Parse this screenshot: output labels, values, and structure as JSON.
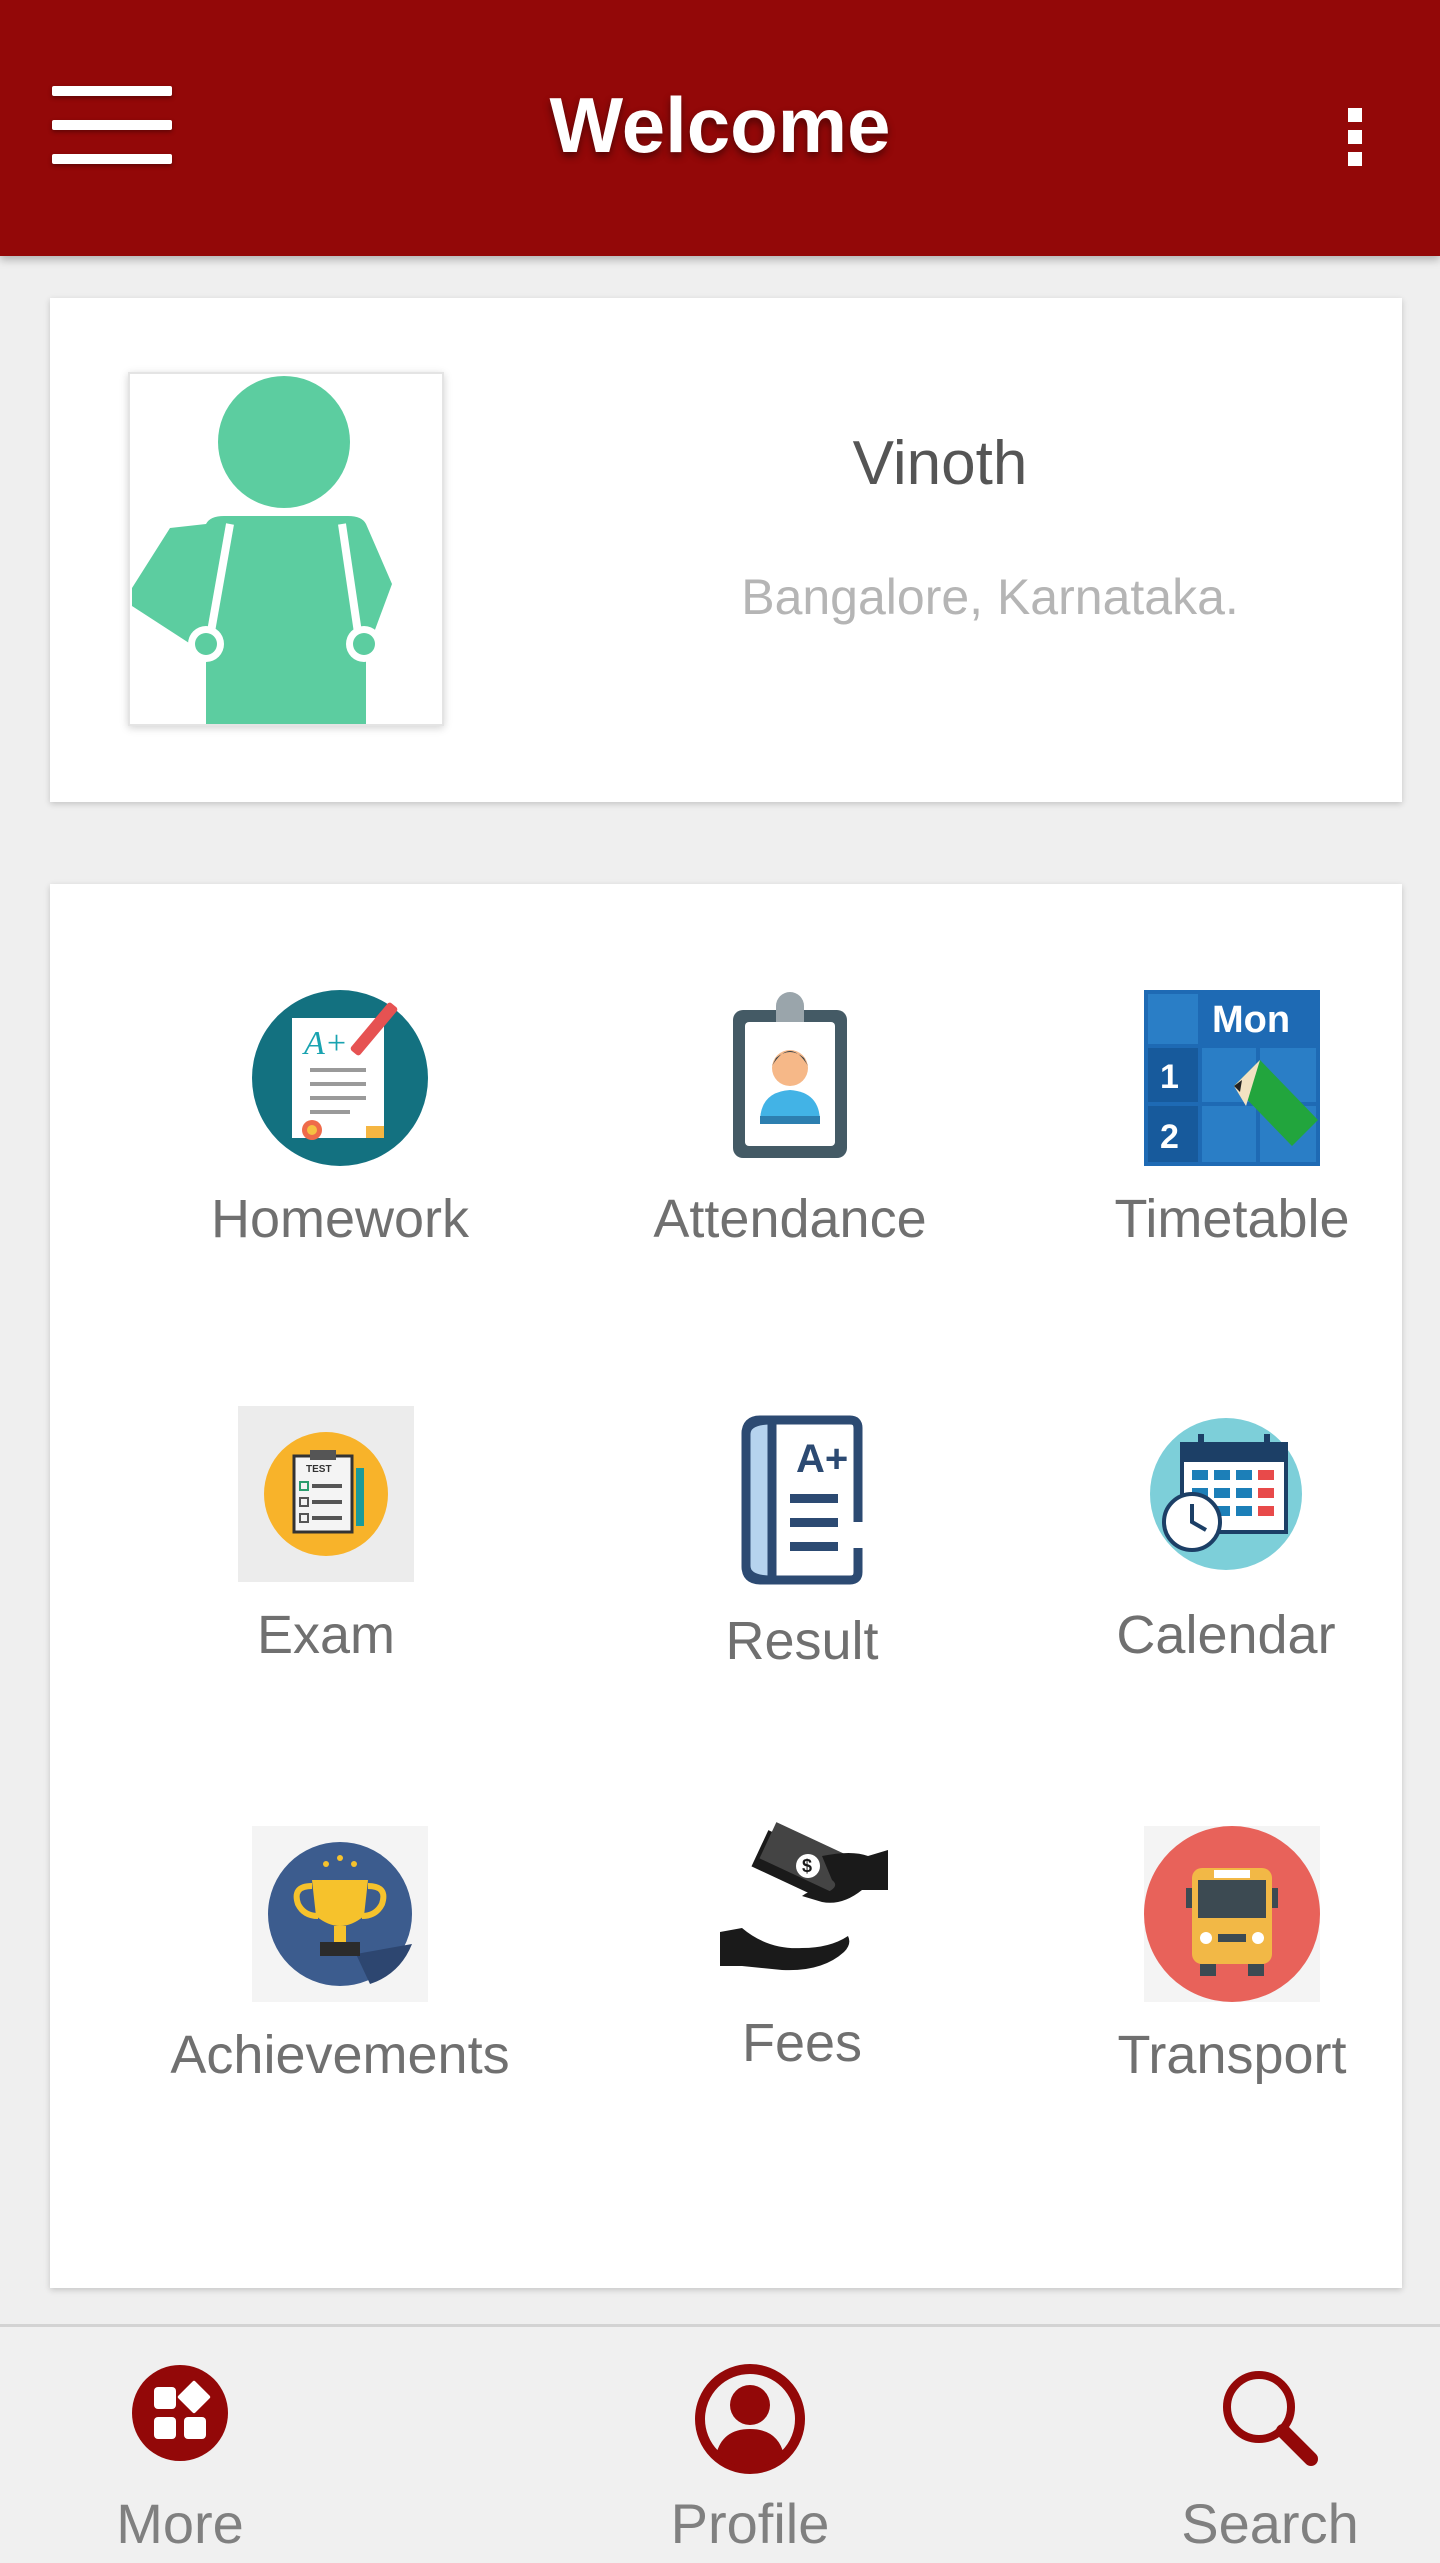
{
  "app_bar": {
    "title": "Welcome",
    "menu_icon": "hamburger-menu-icon",
    "overflow_icon": "more-vert-icon",
    "background": "#930808"
  },
  "profile": {
    "name": "Vinoth",
    "location": "Bangalore, Karnataka.",
    "avatar_icon": "student-avatar-icon",
    "avatar_color": "#5ccda0"
  },
  "modules": [
    {
      "label": "Homework",
      "icon": "homework-icon"
    },
    {
      "label": "Attendance",
      "icon": "attendance-icon"
    },
    {
      "label": "Timetable",
      "icon": "timetable-icon"
    },
    {
      "label": "Exam",
      "icon": "exam-icon"
    },
    {
      "label": "Result",
      "icon": "result-icon"
    },
    {
      "label": "Calendar",
      "icon": "calendar-icon"
    },
    {
      "label": "Achievements",
      "icon": "achievements-icon"
    },
    {
      "label": "Fees",
      "icon": "fees-icon"
    },
    {
      "label": "Transport",
      "icon": "transport-icon"
    }
  ],
  "icon_text": {
    "timetable_day": "Mon",
    "timetable_row1": "1",
    "timetable_row2": "2",
    "homework_grade": "A+",
    "result_grade": "A+",
    "exam_tag": "TEST"
  },
  "bottom_nav": {
    "more": "More",
    "profile": "Profile",
    "search": "Search",
    "accent": "#930808"
  }
}
